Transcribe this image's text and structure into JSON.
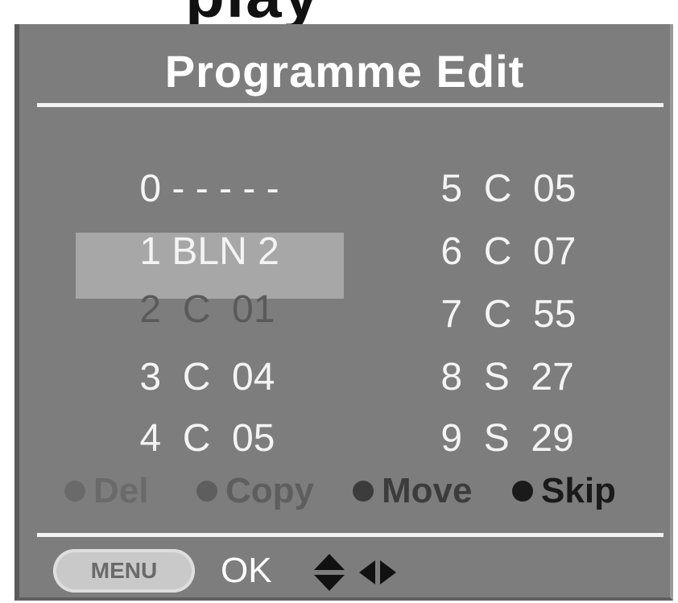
{
  "header_fragment": "play",
  "osd": {
    "title": "Programme Edit",
    "left_column": [
      {
        "number": "0",
        "label": "- - - - -"
      },
      {
        "number": "1",
        "label": "BLN 2"
      },
      {
        "number": "2",
        "label": "C  01"
      },
      {
        "number": "3",
        "label": "C  04"
      },
      {
        "number": "4",
        "label": "C  05"
      }
    ],
    "right_column": [
      {
        "number": "5",
        "label": "C  05"
      },
      {
        "number": "6",
        "label": "C  07"
      },
      {
        "number": "7",
        "label": "C  55"
      },
      {
        "number": "8",
        "label": "S  27"
      },
      {
        "number": "9",
        "label": "S  29"
      }
    ],
    "selected_index": 2,
    "legend": [
      {
        "label": "Del",
        "color": "#6a6a6a"
      },
      {
        "label": "Copy",
        "color": "#5e5e5e"
      },
      {
        "label": "Move",
        "color": "#3c3c3c"
      },
      {
        "label": "Skip",
        "color": "#1a1a1a"
      }
    ],
    "footer": {
      "menu_label": "MENU",
      "ok_label": "OK",
      "icons": [
        "up-down-arrows-icon",
        "left-right-arrows-icon"
      ]
    }
  }
}
